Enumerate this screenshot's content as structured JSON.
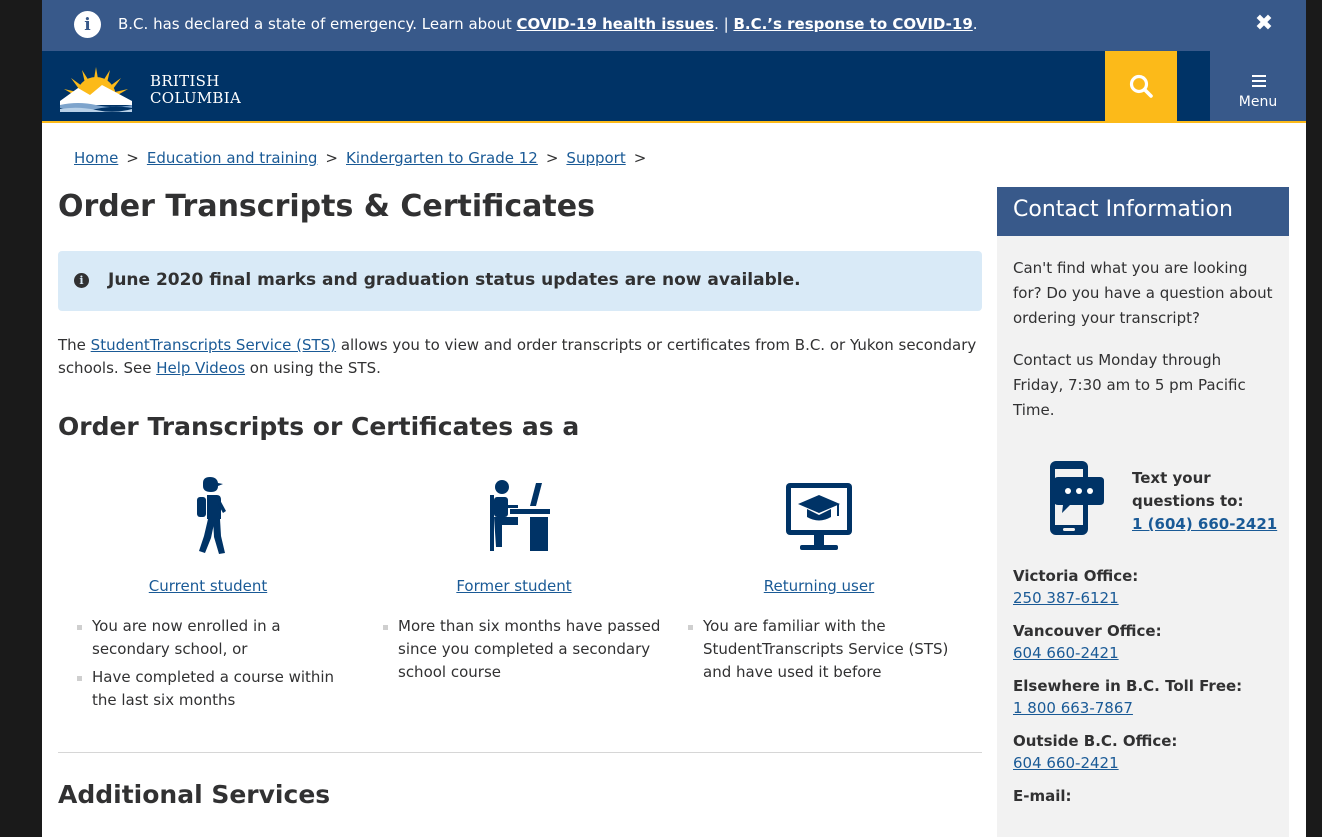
{
  "emergency": {
    "info_glyph": "i",
    "text": "B.C. has declared a state of emergency. Learn about ",
    "link1": "COVID-19 health issues",
    "separator": ". | ",
    "link2": "B.C.’s response to COVID-19",
    "end": ".",
    "close_glyph": "✖"
  },
  "header": {
    "logo_line1": "BRITISH",
    "logo_line2": "COLUMBIA",
    "menu_label": "Menu"
  },
  "breadcrumb": {
    "items": [
      "Home",
      "Education and training",
      "Kindergarten to Grade 12",
      "Support"
    ],
    "separator": ">"
  },
  "page": {
    "title": "Order Transcripts & Certificates",
    "alert_icon": "i",
    "alert_text": "June 2020 final marks and graduation status updates are now available.",
    "intro_prefix": "The ",
    "intro_link1": "StudentTranscripts Service (STS)",
    "intro_mid": " allows you to view and order transcripts or certificates from B.C. or Yukon secondary schools.  See ",
    "intro_link2": "Help Videos",
    "intro_suffix": " on using the STS.",
    "section_title": "Order Transcripts or Certificates as a",
    "additional_title": "Additional Services"
  },
  "cards": [
    {
      "icon": "student-walking-icon",
      "link": "Current student",
      "bullets": [
        "You are now enrolled in a secondary school, or",
        "Have completed a course within the last six months"
      ]
    },
    {
      "icon": "person-at-desk-icon",
      "link": "Former student",
      "bullets": [
        "More than six months have passed since you completed a secondary school course"
      ]
    },
    {
      "icon": "monitor-graduation-cap-icon",
      "link": "Returning user",
      "bullets": [
        "You are familiar with the StudentTranscripts Service (STS) and have used it before"
      ]
    }
  ],
  "sidebar": {
    "title": "Contact Information",
    "p1": "Can't find what you are looking for? Do you have a question about ordering your transcript?",
    "p2": "Contact us Monday through Friday, 7:30 am to 5 pm Pacific Time.",
    "text_line1": "Text your",
    "text_line2": "questions to:",
    "text_phone": "1 (604) 660-2421",
    "contacts": [
      {
        "label": "Victoria Office:",
        "value": "250 387-6121"
      },
      {
        "label": "Vancouver Office:",
        "value": "604 660-2421"
      },
      {
        "label": "Elsewhere in B.C. Toll Free:",
        "value": "1 800 663-7867"
      },
      {
        "label": "Outside B.C. Office:",
        "value": "604 660-2421"
      },
      {
        "label": "E-mail:",
        "value": ""
      }
    ]
  },
  "colors": {
    "header_navy": "#003366",
    "banner_blue": "#38598a",
    "gold": "#fcba19",
    "link": "#1a5a96",
    "alert_bg": "#d9eaf7",
    "icon_navy": "#003366"
  }
}
